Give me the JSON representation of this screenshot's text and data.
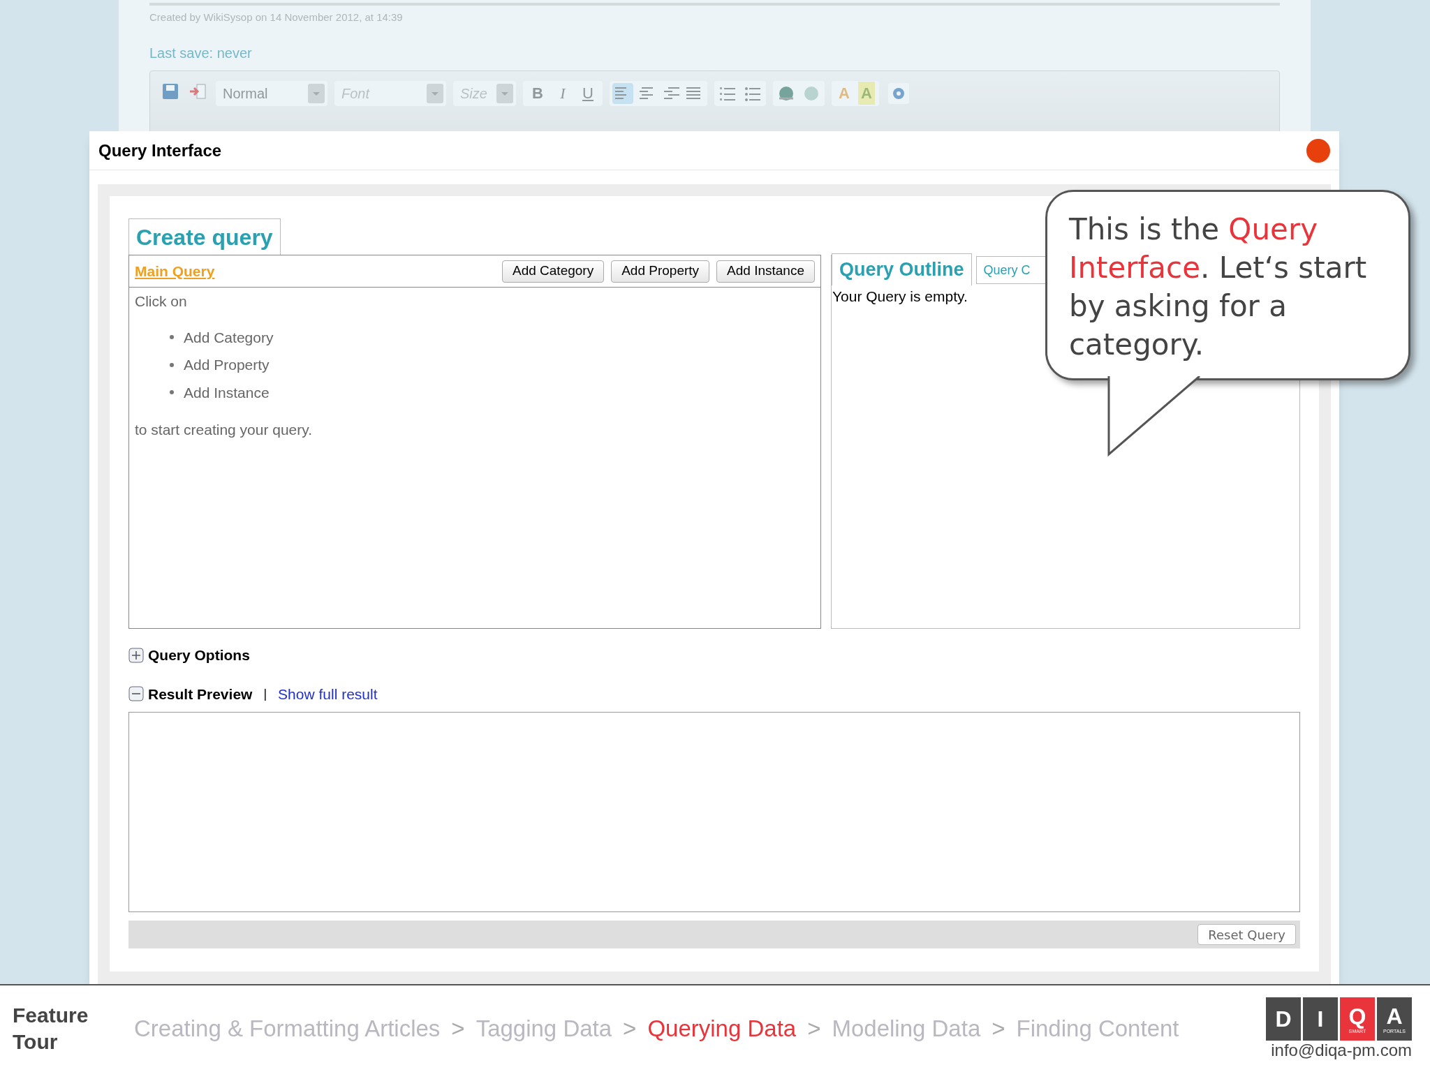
{
  "editor": {
    "created": "Created by WikiSysop on 14 November 2012, at 14:39",
    "last_save": "Last save: never",
    "toolbar": {
      "format": "Normal",
      "font": "Font",
      "size": "Size",
      "styles": [
        {
          "label": "B",
          "kind": "bold"
        },
        {
          "label": "I",
          "kind": "italic"
        },
        {
          "label": "U",
          "kind": "underline"
        }
      ],
      "alignments": [
        {
          "kind": "left",
          "selected": true
        },
        {
          "kind": "center",
          "selected": false
        },
        {
          "kind": "right",
          "selected": false
        },
        {
          "kind": "justify",
          "selected": false
        }
      ],
      "colors": [
        {
          "label": "A",
          "kind": "text"
        },
        {
          "label": "A",
          "kind": "background"
        }
      ]
    }
  },
  "dialog": {
    "title": "Query Interface",
    "tab": "Create query",
    "main_query": {
      "title": "Main Query",
      "buttons": [
        "Add Category",
        "Add Property",
        "Add Instance"
      ],
      "intro": "Click on",
      "items": [
        "Add Category",
        "Add Property",
        "Add Instance"
      ],
      "outro": "to start creating your query."
    },
    "outline": {
      "tabs": [
        {
          "label": "Query Outline",
          "selected": true
        },
        {
          "label": "Query C",
          "selected": false
        }
      ],
      "message": "Your Query is empty."
    },
    "sections": [
      {
        "label": "Query Options",
        "expanded": false
      },
      {
        "label": "Result Preview",
        "expanded": true
      }
    ],
    "separator": "|",
    "show_full_result": "Show full result",
    "reset_button": "Reset Query"
  },
  "callout": [
    {
      "text": "This is the ",
      "highlight": false
    },
    {
      "text": "Query Interface",
      "highlight": true
    },
    {
      "text": ". Let‘s start by asking for a category.",
      "highlight": false
    }
  ],
  "footer": {
    "title": "Feature Tour",
    "breadcrumb": [
      {
        "label": "Creating & Formatting Articles",
        "selected": false
      },
      {
        "label": "Tagging Data",
        "selected": false
      },
      {
        "label": "Querying Data",
        "selected": true
      },
      {
        "label": "Modeling Data",
        "selected": false
      },
      {
        "label": "Finding Content",
        "selected": false
      }
    ],
    "separators": [
      ">",
      ">",
      ">",
      ">"
    ],
    "logo": {
      "letters": [
        {
          "letter": "D"
        },
        {
          "letter": "I"
        },
        {
          "letter": "Q",
          "sub": "SMART"
        },
        {
          "letter": "A",
          "sub": "PORTALS"
        }
      ],
      "email": "info@diqa-pm.com"
    }
  }
}
